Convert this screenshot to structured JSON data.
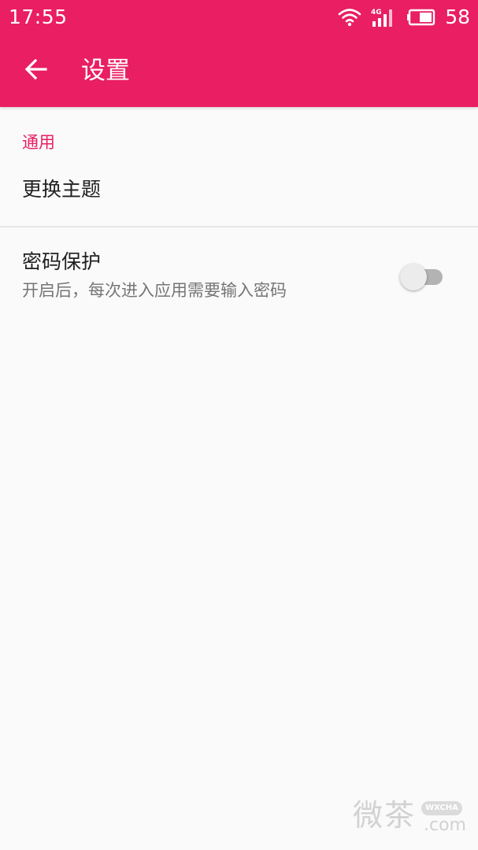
{
  "status_bar": {
    "time": "17:55",
    "network_type": "4G",
    "battery_level": "58",
    "icons": [
      "wifi-icon",
      "cellular-signal-icon",
      "battery-icon"
    ]
  },
  "app_bar": {
    "back_icon": "arrow-left-icon",
    "title": "设置"
  },
  "settings": {
    "category_general": "通用",
    "theme_item": {
      "title": "更换主题"
    },
    "password_item": {
      "title": "密码保护",
      "summary": "开启后，每次进入应用需要输入密码",
      "enabled": false
    }
  },
  "watermark": {
    "main": "微茶",
    "badge": "WXCHA",
    "domain": ".com"
  },
  "colors": {
    "primary": "#e91e63",
    "background": "#fafafa",
    "text_primary": "#212121",
    "text_secondary": "#757575",
    "divider": "#e6e6e6",
    "switch_track_off": "#b3b3b3",
    "switch_thumb_off": "#ececec"
  }
}
